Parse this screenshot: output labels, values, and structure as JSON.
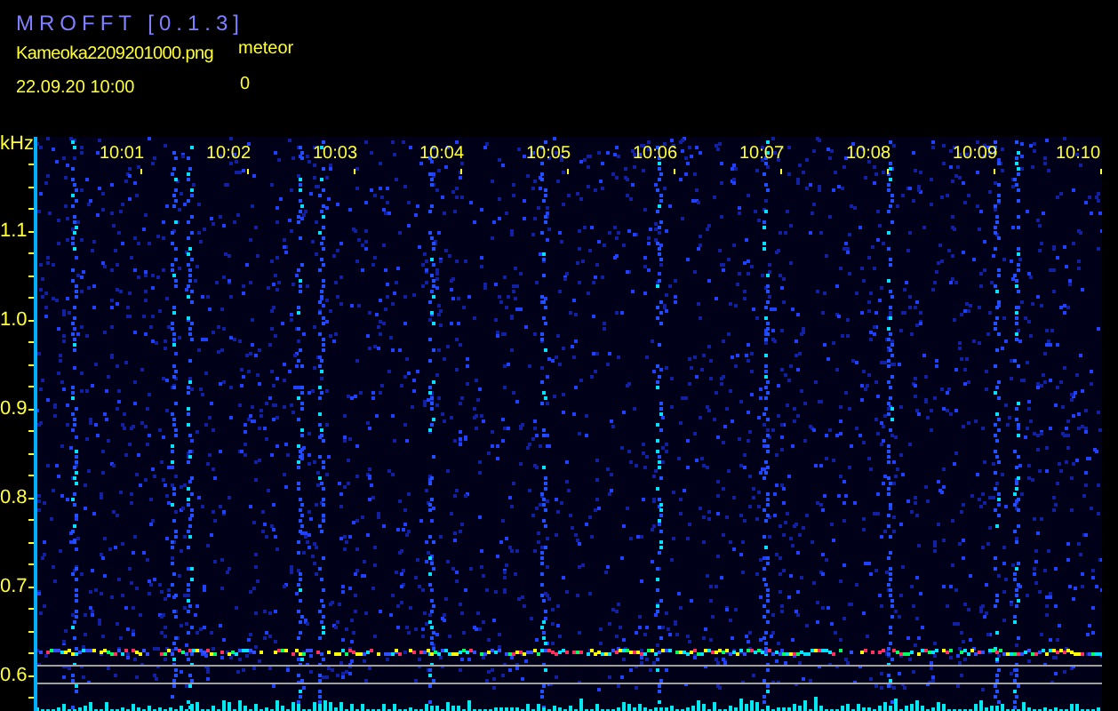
{
  "app_title": "MROFFT [0.1.3]",
  "file_name": "Kameoka2209201000.png",
  "meteor_label": "meteor",
  "date_time": "22.09.20 10:00",
  "meteor_count": "0",
  "y_axis": {
    "unit": "kHz",
    "labels": [
      "1.1",
      "1.0",
      "0.9",
      "0.8",
      "0.7",
      "0.6"
    ]
  },
  "time_labels": [
    "10:01",
    "10:02",
    "10:03",
    "10:04",
    "10:05",
    "10:06",
    "10:07",
    "10:08",
    "10:09",
    "10:10"
  ]
}
